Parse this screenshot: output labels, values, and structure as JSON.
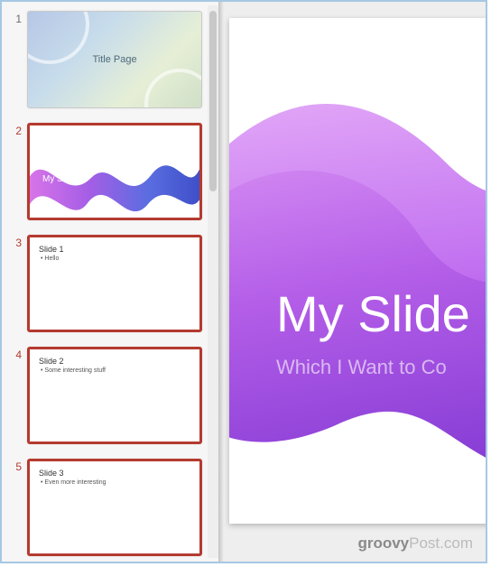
{
  "thumbnails": [
    {
      "number": "1",
      "title": "Title Page",
      "selected": false
    },
    {
      "number": "2",
      "title": "My Slide",
      "selected": true
    },
    {
      "number": "3",
      "title": "Slide 1",
      "bullet": "• Hello",
      "selected": true
    },
    {
      "number": "4",
      "title": "Slide 2",
      "bullet": "• Some interesting stuff",
      "selected": true
    },
    {
      "number": "5",
      "title": "Slide 3",
      "bullet": "• Even more interesting",
      "selected": true
    }
  ],
  "main_slide": {
    "title": "My Slide",
    "subtitle": "Which I Want to Co"
  },
  "watermark": {
    "brand": "groovy",
    "suffix": "Post.com"
  }
}
